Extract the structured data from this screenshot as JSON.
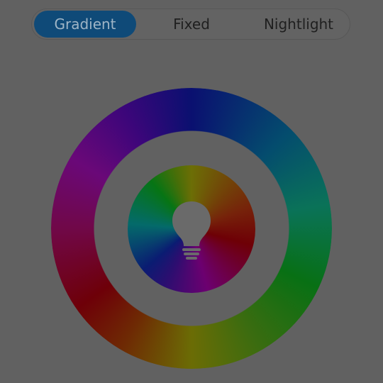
{
  "mode_selector": {
    "options": [
      "Gradient",
      "Fixed",
      "Nightlight"
    ],
    "selected": "Gradient"
  },
  "colors": {
    "background": "#616161",
    "selected_tab": "#0f4a78",
    "selected_tab_text": "#9fb5c6",
    "tab_text": "#1f1f1f",
    "bulb": "#6a6a6a"
  },
  "icons": {
    "center": "lightbulb-icon"
  }
}
